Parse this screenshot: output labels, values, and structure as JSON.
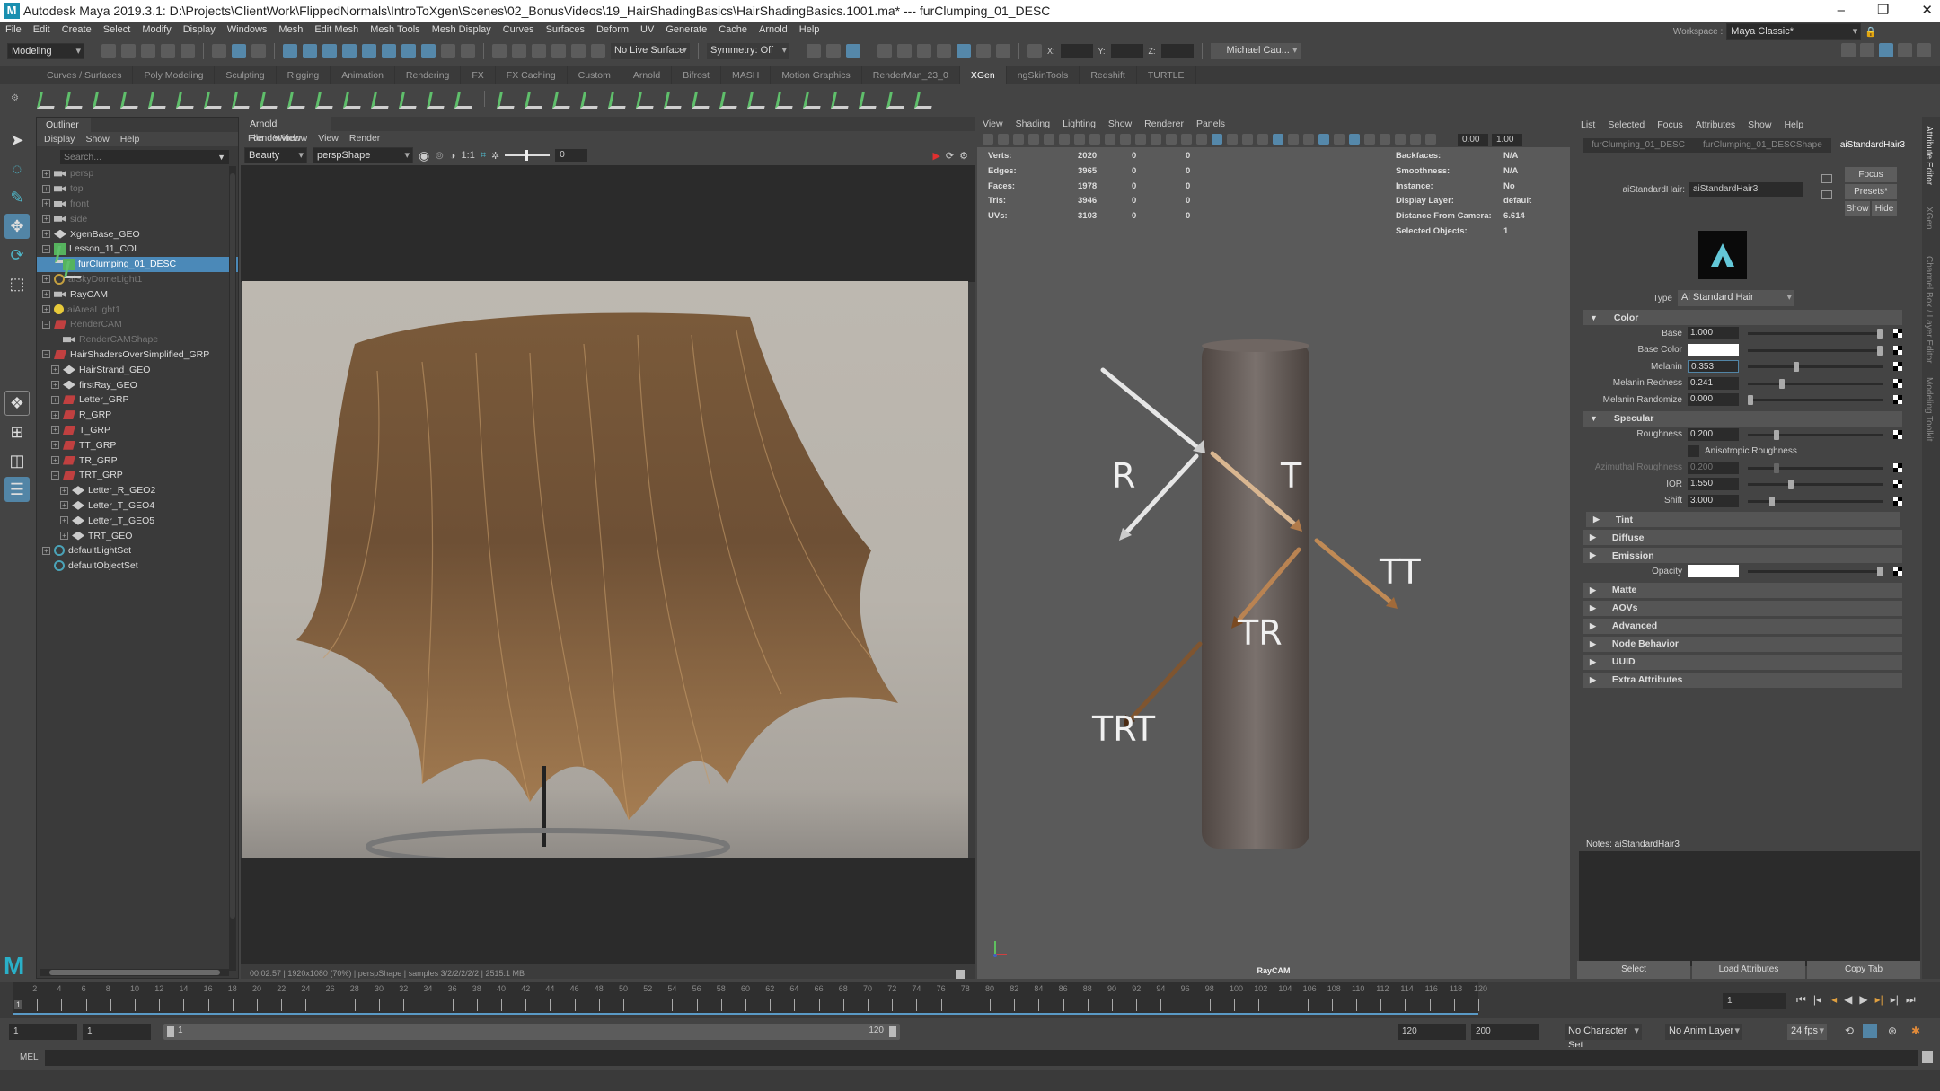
{
  "window": {
    "title": "Autodesk Maya 2019.3.1: D:\\Projects\\ClientWork\\FlippedNormals\\IntroToXgen\\Scenes\\02_BonusVideos\\19_HairShadingBasics\\HairShadingBasics.1001.ma*  ---  furClumping_01_DESC",
    "controls": [
      "–",
      "❐",
      "✕"
    ]
  },
  "menubar": [
    "File",
    "Edit",
    "Create",
    "Select",
    "Modify",
    "Display",
    "Windows",
    "Mesh",
    "Edit Mesh",
    "Mesh Tools",
    "Mesh Display",
    "Curves",
    "Surfaces",
    "Deform",
    "UV",
    "Generate",
    "Cache",
    "Arnold",
    "Help"
  ],
  "statusline": {
    "menuset": "Modeling",
    "live_surface": "No Live Surface",
    "symmetry": "Symmetry: Off",
    "x_label": "X:",
    "y_label": "Y:",
    "z_label": "Z:",
    "user": "Michael Cau...",
    "workspace_label": "Workspace :",
    "workspace": "Maya Classic*"
  },
  "shelf": {
    "tabs": [
      "Curves / Surfaces",
      "Poly Modeling",
      "Sculpting",
      "Rigging",
      "Animation",
      "Rendering",
      "FX",
      "FX Caching",
      "Custom",
      "Arnold",
      "Bifrost",
      "MASH",
      "Motion Graphics",
      "RenderMan_23_0",
      "XGen",
      "ngSkinTools",
      "Redshift",
      "TURTLE"
    ],
    "active_tab": "XGen"
  },
  "outliner": {
    "title": "Outliner",
    "menu": [
      "Display",
      "Show",
      "Help"
    ],
    "search_placeholder": "Search...",
    "items": [
      {
        "label": "persp",
        "icon": "camera",
        "depth": 0,
        "dim": true
      },
      {
        "label": "top",
        "icon": "camera",
        "depth": 0,
        "dim": true
      },
      {
        "label": "front",
        "icon": "camera",
        "depth": 0,
        "dim": true
      },
      {
        "label": "side",
        "icon": "camera",
        "depth": 0,
        "dim": true
      },
      {
        "label": "XgenBase_GEO",
        "icon": "mesh",
        "depth": 0
      },
      {
        "label": "Lesson_11_COL",
        "icon": "xgen",
        "depth": 0,
        "expanded": true
      },
      {
        "label": "furClumping_01_DESC",
        "icon": "xgen",
        "depth": 1,
        "selected": true
      },
      {
        "label": "aiSkyDomeLight1",
        "icon": "dome",
        "depth": 0,
        "dim": true
      },
      {
        "label": "RayCAM",
        "icon": "camera",
        "depth": 0
      },
      {
        "label": "aiAreaLight1",
        "icon": "light",
        "depth": 0,
        "dim": true
      },
      {
        "label": "RenderCAM",
        "icon": "group",
        "depth": 0,
        "dim": true,
        "expanded": true
      },
      {
        "label": "RenderCAMShape",
        "icon": "camera",
        "depth": 1,
        "dim": true
      },
      {
        "label": "HairShadersOverSimplified_GRP",
        "icon": "group",
        "depth": 0,
        "expanded": true
      },
      {
        "label": "HairStrand_GEO",
        "icon": "mesh",
        "depth": 1
      },
      {
        "label": "firstRay_GEO",
        "icon": "mesh",
        "depth": 1
      },
      {
        "label": "Letter_GRP",
        "icon": "group",
        "depth": 1
      },
      {
        "label": "R_GRP",
        "icon": "group",
        "depth": 1
      },
      {
        "label": "T_GRP",
        "icon": "group",
        "depth": 1
      },
      {
        "label": "TT_GRP",
        "icon": "group",
        "depth": 1
      },
      {
        "label": "TR_GRP",
        "icon": "group",
        "depth": 1
      },
      {
        "label": "TRT_GRP",
        "icon": "group",
        "depth": 1,
        "expanded": true
      },
      {
        "label": "Letter_R_GEO2",
        "icon": "mesh",
        "depth": 2
      },
      {
        "label": "Letter_T_GEO4",
        "icon": "mesh",
        "depth": 2
      },
      {
        "label": "Letter_T_GEO5",
        "icon": "mesh",
        "depth": 2
      },
      {
        "label": "TRT_GEO",
        "icon": "mesh",
        "depth": 2
      },
      {
        "label": "defaultLightSet",
        "icon": "set",
        "depth": 0
      },
      {
        "label": "defaultObjectSet",
        "icon": "set",
        "depth": 0
      }
    ]
  },
  "renderview": {
    "title": "Arnold RenderView",
    "menu": [
      "File",
      "Window",
      "View",
      "Render"
    ],
    "aov": "Beauty",
    "camera": "perspShape",
    "ratio": "1:1",
    "exposure": "0",
    "status": "00:02:57 | 1920x1080 (70%) | perspShape  | samples 3/2/2/2/2/2 | 2515.1 MB"
  },
  "viewport": {
    "menu": [
      "View",
      "Shading",
      "Lighting",
      "Show",
      "Renderer",
      "Panels"
    ],
    "near": "0.00",
    "far": "1.00",
    "camera_label": "RayCAM",
    "hud_left": [
      {
        "label": "Verts:",
        "values": [
          "2020",
          "0",
          "0"
        ]
      },
      {
        "label": "Edges:",
        "values": [
          "3965",
          "0",
          "0"
        ]
      },
      {
        "label": "Faces:",
        "values": [
          "1978",
          "0",
          "0"
        ]
      },
      {
        "label": "Tris:",
        "values": [
          "3946",
          "0",
          "0"
        ]
      },
      {
        "label": "UVs:",
        "values": [
          "3103",
          "0",
          "0"
        ]
      }
    ],
    "hud_right": [
      {
        "label": "Backfaces:",
        "value": "N/A"
      },
      {
        "label": "Smoothness:",
        "value": "N/A"
      },
      {
        "label": "Instance:",
        "value": "No"
      },
      {
        "label": "Display Layer:",
        "value": "default"
      },
      {
        "label": "Distance From Camera:",
        "value": "6.614"
      },
      {
        "label": "Selected Objects:",
        "value": "1"
      }
    ],
    "diagram_labels": {
      "r": "R",
      "t": "T",
      "tt": "TT",
      "tr": "TR",
      "trt": "TRT"
    }
  },
  "attribute_editor": {
    "menu": [
      "List",
      "Selected",
      "Focus",
      "Attributes",
      "Show",
      "Help"
    ],
    "tabs": [
      "furClumping_01_DESC",
      "furClumping_01_DESCShape",
      "aiStandardHair3"
    ],
    "active_tab": "aiStandardHair3",
    "node_label": "aiStandardHair:",
    "node_name": "aiStandardHair3",
    "buttons": {
      "focus": "Focus",
      "presets": "Presets*",
      "show": "Show",
      "hide": "Hide"
    },
    "type_label": "Type",
    "type_value": "Ai Standard Hair",
    "sections": {
      "color": {
        "title": "Color",
        "attrs": [
          {
            "label": "Base",
            "value": "1.000",
            "slider": 1.0
          },
          {
            "label": "Base Color",
            "value": "",
            "swatch": "#ffffff",
            "slider": 1.0
          },
          {
            "label": "Melanin",
            "value": "0.353",
            "slider": 0.353,
            "focused": true
          },
          {
            "label": "Melanin Redness",
            "value": "0.241",
            "slider": 0.241
          },
          {
            "label": "Melanin Randomize",
            "value": "0.000",
            "slider": 0.0
          }
        ]
      },
      "specular": {
        "title": "Specular",
        "attrs": [
          {
            "label": "Roughness",
            "value": "0.200",
            "slider": 0.2
          },
          {
            "label": "Azimuthal Roughness",
            "value": "0.200",
            "slider": 0.2,
            "disabled": true
          },
          {
            "label": "IOR",
            "value": "1.550",
            "slider": 0.31
          },
          {
            "label": "Shift",
            "value": "3.000",
            "slider": 0.17
          }
        ],
        "checkbox_label": "Anisotropic Roughness",
        "checkbox_checked": false
      },
      "collapsed_a": [
        "Tint",
        "Diffuse",
        "Emission"
      ],
      "opacity_label": "Opacity",
      "collapsed_b": [
        "Matte",
        "AOVs",
        "Advanced",
        "Node Behavior",
        "UUID",
        "Extra Attributes"
      ]
    },
    "notes_label": "Notes:  aiStandardHair3",
    "bottom_buttons": [
      "Select",
      "Load Attributes",
      "Copy Tab"
    ]
  },
  "side_tabs": [
    "Attribute Editor",
    "XGen",
    "Channel Box / Layer Editor",
    "Modeling Toolkit"
  ],
  "timeline": {
    "ticks": [
      "2",
      "4",
      "6",
      "8",
      "10",
      "12",
      "14",
      "16",
      "18",
      "20",
      "22",
      "24",
      "26",
      "28",
      "30",
      "32",
      "34",
      "36",
      "38",
      "40",
      "42",
      "44",
      "46",
      "48",
      "50",
      "52",
      "54",
      "56",
      "58",
      "60",
      "62",
      "64",
      "66",
      "68",
      "70",
      "72",
      "74",
      "76",
      "78",
      "80",
      "82",
      "84",
      "86",
      "88",
      "90",
      "92",
      "94",
      "96",
      "98",
      "100",
      "102",
      "104",
      "106",
      "108",
      "110",
      "112",
      "114",
      "116",
      "118",
      "120"
    ],
    "current_frame_marker": "1",
    "current_frame": "1"
  },
  "range": {
    "start": "1",
    "anim_start": "1",
    "range_start": "1",
    "range_end": "120",
    "end": "120",
    "anim_end": "200",
    "character_set": "No Character Set",
    "anim_layer": "No Anim Layer",
    "fps": "24 fps"
  },
  "command_line": {
    "label": "MEL"
  }
}
